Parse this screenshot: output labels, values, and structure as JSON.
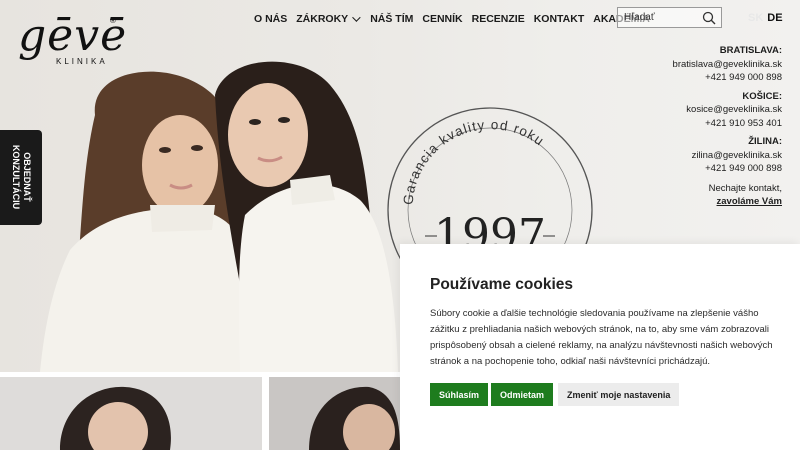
{
  "logo": {
    "text": "gēvē",
    "sub": "KLINIKA",
    "reg": "®"
  },
  "nav": {
    "items": [
      {
        "label": "O NÁS"
      },
      {
        "label": "ZÁKROKY",
        "dropdown": true
      },
      {
        "label": "NÁŠ TÍM"
      },
      {
        "label": "CENNÍK"
      },
      {
        "label": "RECENZIE"
      },
      {
        "label": "KONTAKT"
      },
      {
        "label": "AKADÉMIA"
      }
    ]
  },
  "search": {
    "placeholder": "Hľadať"
  },
  "lang": {
    "sk": "SK",
    "de": "DE"
  },
  "contacts": {
    "bratislava": {
      "city": "BRATISLAVA:",
      "email": "bratislava@geveklinika.sk",
      "phone": "+421 949 000 898"
    },
    "kosice": {
      "city": "KOŠICE:",
      "email": "kosice@geveklinika.sk",
      "phone": "+421 910 953 401"
    },
    "zilina": {
      "city": "ŽILINA:",
      "email": "zilina@geveklinika.sk",
      "phone": "+421 949 000 898"
    },
    "note": "Nechajte kontakt,",
    "callback": "zavoláme Vám"
  },
  "side_tab": {
    "line1": "OBJEDNAŤ",
    "line2": "KONZULTÁCIU"
  },
  "badge": {
    "arc_text": "Garancia kvality od roku",
    "year": "1997"
  },
  "cookie": {
    "title": "Používame cookies",
    "text": "Súbory cookie a ďalšie technológie sledovania používame na zlepšenie vášho zážitku z prehliadania našich webových stránok, na to, aby sme vám zobrazovali prispôsobený obsah a cielené reklamy, na analýzu návštevnosti našich webových stránok a na pochopenie toho, odkiaľ naši návštevníci prichádzajú.",
    "accept_label": "Súhlasím",
    "reject_label": "Odmietam",
    "settings_label": "Zmeniť moje nastavenia"
  },
  "colors": {
    "accept": "#1e7c1e",
    "dark": "#1a1a1a",
    "background": "#ebe9e5"
  }
}
